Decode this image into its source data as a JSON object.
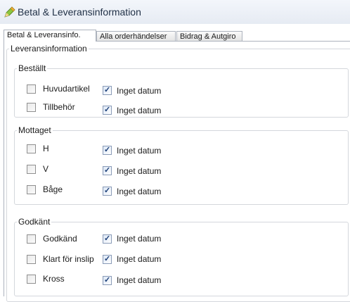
{
  "window": {
    "title": "Betal & Leveransinformation",
    "icon": "app-pencil-icon"
  },
  "tabs": [
    {
      "label": "Betal & Leveransinfo.",
      "active": true
    },
    {
      "label": "Alla orderhändelser",
      "active": false
    },
    {
      "label": "Bidrag & Autgiro",
      "active": false
    }
  ],
  "section": {
    "title": "Leveransinformation"
  },
  "groups": {
    "bestallt": {
      "title": "Beställt",
      "rows": [
        {
          "label": "Huvudartikel",
          "checked": false,
          "date_label": "Inget datum",
          "date_checked": true
        },
        {
          "label": "Tillbehör",
          "checked": false,
          "date_label": "Inget datum",
          "date_checked": true
        }
      ]
    },
    "mottaget": {
      "title": "Mottaget",
      "rows": [
        {
          "label": "H",
          "checked": false,
          "date_label": "Inget datum",
          "date_checked": true
        },
        {
          "label": "V",
          "checked": false,
          "date_label": "Inget datum",
          "date_checked": true
        },
        {
          "label": "Båge",
          "checked": false,
          "date_label": "Inget datum",
          "date_checked": true
        }
      ]
    },
    "godkant": {
      "title": "Godkänt",
      "rows": [
        {
          "label": "Godkänd",
          "checked": false,
          "date_label": "Inget datum",
          "date_checked": true
        },
        {
          "label": "Klart för inslip",
          "checked": false,
          "date_label": "Inget datum",
          "date_checked": true
        },
        {
          "label": "Kross",
          "checked": false,
          "date_label": "Inget datum",
          "date_checked": true
        }
      ]
    }
  }
}
